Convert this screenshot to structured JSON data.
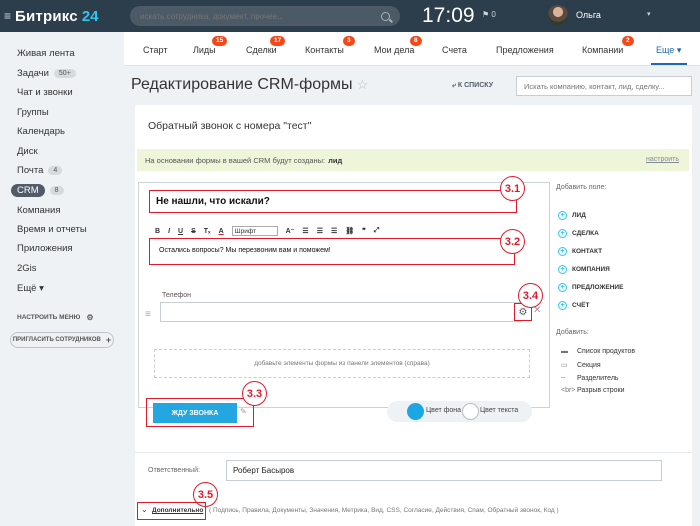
{
  "top": {
    "logo_text": "Битрикс",
    "logo_num": "24",
    "search_placeholder": "искать сотрудника, документ, прочее...",
    "clock": "17:09",
    "flag": "⚑ 0",
    "username": "Ольга",
    "user_arrow": "▾"
  },
  "sidebar": {
    "items": [
      {
        "label": "Живая лента",
        "badge": ""
      },
      {
        "label": "Задачи",
        "badge": "50+"
      },
      {
        "label": "Чат и звонки",
        "badge": ""
      },
      {
        "label": "Группы",
        "badge": ""
      },
      {
        "label": "Календарь",
        "badge": ""
      },
      {
        "label": "Диск",
        "badge": ""
      },
      {
        "label": "Почта",
        "badge": "4"
      },
      {
        "label": "CRM",
        "badge": "8"
      },
      {
        "label": "Компания",
        "badge": ""
      },
      {
        "label": "Время и отчеты",
        "badge": ""
      },
      {
        "label": "Приложения",
        "badge": ""
      },
      {
        "label": "2Gis",
        "badge": ""
      },
      {
        "label": "Ещё ▾",
        "badge": ""
      }
    ],
    "configure_menu": "НАСТРОИТЬ МЕНЮ",
    "invite": "ПРИГЛАСИТЬ СОТРУДНИКОВ"
  },
  "menu": {
    "items": [
      {
        "label": "Старт",
        "badge": ""
      },
      {
        "label": "Лиды",
        "badge": "15"
      },
      {
        "label": "Сделки",
        "badge": "17"
      },
      {
        "label": "Контакты",
        "badge": "3"
      },
      {
        "label": "Мои дела",
        "badge": "8"
      },
      {
        "label": "Счета",
        "badge": ""
      },
      {
        "label": "Предложения",
        "badge": ""
      },
      {
        "label": "Компании",
        "badge": "2"
      },
      {
        "label": "Еще ▾",
        "badge": ""
      }
    ]
  },
  "page": {
    "title": "Редактирование CRM-формы",
    "star": "☆",
    "back_link": "⤶ К СПИСКУ",
    "search_placeholder": "Искать компанию, контакт, лид, сделку..."
  },
  "card": {
    "title": "Обратный звонок с номера \"тест\"",
    "info_text": "На основании формы в вашей CRM будут созданы:",
    "info_bold": "лид",
    "info_link": "настроить",
    "heading": "Не нашли, что искали?",
    "toolbar": [
      "B",
      "I",
      "U",
      "S",
      "Tₓ",
      "A",
      "Шрифт",
      "A⁻",
      "☰",
      "☰",
      "☰",
      "⛓",
      "❞",
      "⤢"
    ],
    "text": "Остались вопросы? Мы перезвоним вам и поможем!",
    "phone_label": "Телефон",
    "dropzone": "добавьте элементы формы из панели элементов (справа)",
    "submit": "ЖДУ ЗВОНКА",
    "bg_color": "Цвет фона",
    "text_color": "Цвет текста"
  },
  "right_panel": {
    "add_field": "Добавить поле:",
    "fields": [
      "ЛИД",
      "СДЕЛКА",
      "КОНТАКТ",
      "КОМПАНИЯ",
      "ПРЕДЛОЖЕНИЕ",
      "СЧЁТ"
    ],
    "add": "Добавить:",
    "elements": [
      {
        "icon": "▬",
        "label": "Список продуктов"
      },
      {
        "icon": "▭",
        "label": "Секция"
      },
      {
        "icon": "┄",
        "label": "Разделитель"
      },
      {
        "icon": "<br>",
        "label": "Разрыв строки"
      }
    ]
  },
  "markers": [
    "3.1",
    "3.2",
    "3.4",
    "3.3",
    "3.5"
  ],
  "bottom": {
    "responsible_label": "Ответственный:",
    "responsible_value": "Роберт Басыров",
    "more_label": "Дополнительно",
    "more_list": "( Подпись, Правила, Документы, Значения, Метрика, Вид, CSS, Согласие, Действия, Спам, Обратный звонок, Код  )"
  },
  "colors": {
    "accent": "#2067b0",
    "topbar": "#2c3e4c",
    "marker": "#e11a2b",
    "button": "#24a7e0",
    "badge": "#f54819"
  }
}
